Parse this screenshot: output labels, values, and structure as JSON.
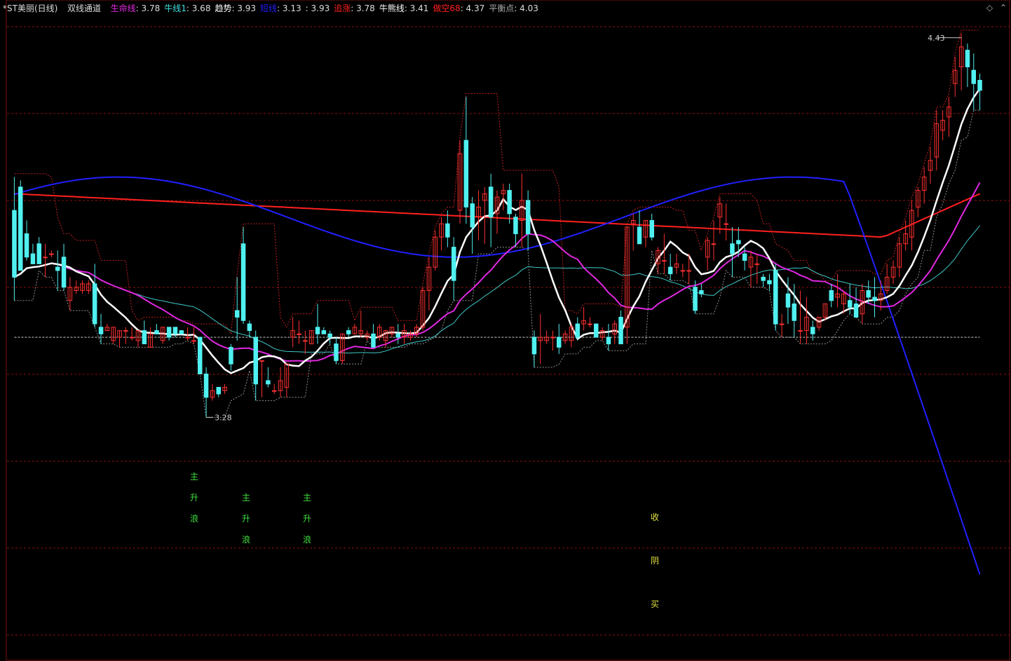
{
  "legend": {
    "stock": "*ST美丽(日线)",
    "indicator": "双线通道",
    "items": [
      {
        "label": "生命线",
        "value": "3.78",
        "color": "#e028e0"
      },
      {
        "label": "牛线1",
        "value": "3.68",
        "color": "#40e0e0"
      },
      {
        "label": "趋势",
        "value": "3.93",
        "color": "#ffffff"
      },
      {
        "label": "短线",
        "value": "3.13",
        "color": "#2020ff"
      },
      {
        "label": "",
        "value": "3.93",
        "color": "#ffffff"
      },
      {
        "label": "追涨",
        "value": "3.78",
        "color": "#ff2020"
      },
      {
        "label": "牛熊线",
        "value": "3.41",
        "color": "#ffffff"
      },
      {
        "label": "做空68",
        "value": "4.37",
        "color": "#ff2020"
      },
      {
        "label": "平衡点",
        "value": "4.03",
        "color": "#aaaaaa"
      }
    ]
  },
  "icons": [
    "diamond-icon",
    "chevron-up-icon"
  ],
  "chart_data": {
    "type": "candlestick",
    "high_marker": "4.43",
    "low_marker": "3.28",
    "annotations": [
      {
        "chars": [
          "主",
          "升",
          "浪"
        ],
        "color": "#40e040"
      },
      {
        "chars": [
          "主",
          "升",
          "浪"
        ],
        "color": "#40e040"
      },
      {
        "chars": [
          "主",
          "升",
          "浪"
        ],
        "color": "#40e040"
      },
      {
        "chars": [
          "收",
          "阴",
          "买"
        ],
        "color": "#e0e040"
      }
    ],
    "colors": {
      "up": "#ff3030",
      "down": "#50f0f0",
      "grid": "#8a1010",
      "trend_white": "#ffffff",
      "life_magenta": "#e028e0",
      "bull_cyan": "#40c8c8",
      "short_blue": "#2020ff",
      "long_red": "#ff2020",
      "balance": "#cccccc"
    },
    "candles": [
      [
        3.9,
        4.0,
        3.63,
        3.7
      ],
      [
        3.97,
        3.99,
        3.72,
        3.72
      ],
      [
        3.83,
        3.87,
        3.75,
        3.76
      ],
      [
        3.77,
        3.8,
        3.74,
        3.74
      ],
      [
        3.8,
        3.82,
        3.74,
        3.74
      ],
      [
        3.76,
        3.8,
        3.7,
        3.76
      ],
      [
        3.77,
        3.78,
        3.76,
        3.77
      ],
      [
        3.73,
        3.78,
        3.66,
        3.72
      ],
      [
        3.76,
        3.8,
        3.66,
        3.67
      ],
      [
        3.63,
        3.7,
        3.6,
        3.67
      ],
      [
        3.66,
        3.69,
        3.65,
        3.67
      ],
      [
        3.66,
        3.69,
        3.65,
        3.68
      ],
      [
        3.66,
        3.69,
        3.65,
        3.68
      ],
      [
        3.68,
        3.74,
        3.55,
        3.56
      ],
      [
        3.55,
        3.59,
        3.5,
        3.53
      ],
      [
        3.54,
        3.56,
        3.54,
        3.55
      ],
      [
        3.51,
        3.55,
        3.5,
        3.55
      ],
      [
        3.52,
        3.54,
        3.49,
        3.54
      ],
      [
        3.54,
        3.55,
        3.5,
        3.54
      ],
      [
        3.52,
        3.55,
        3.51,
        3.52
      ],
      [
        3.51,
        3.54,
        3.49,
        3.54
      ],
      [
        3.54,
        3.57,
        3.5,
        3.5
      ],
      [
        3.49,
        3.55,
        3.49,
        3.53
      ],
      [
        3.54,
        3.56,
        3.53,
        3.53
      ],
      [
        3.51,
        3.55,
        3.5,
        3.55
      ],
      [
        3.55,
        3.55,
        3.51,
        3.52
      ],
      [
        3.55,
        3.55,
        3.52,
        3.53
      ],
      [
        3.54,
        3.54,
        3.53,
        3.53
      ],
      [
        3.52,
        3.55,
        3.51,
        3.52
      ],
      [
        3.51,
        3.55,
        3.5,
        3.51
      ],
      [
        3.52,
        3.52,
        3.41,
        3.41
      ],
      [
        3.41,
        3.43,
        3.28,
        3.34
      ],
      [
        3.34,
        3.38,
        3.33,
        3.36
      ],
      [
        3.37,
        3.37,
        3.34,
        3.35
      ],
      [
        3.36,
        3.38,
        3.35,
        3.37
      ],
      [
        3.49,
        3.5,
        3.42,
        3.44
      ],
      [
        3.6,
        3.7,
        3.51,
        3.58
      ],
      [
        3.8,
        3.85,
        3.56,
        3.57
      ],
      [
        3.56,
        3.57,
        3.52,
        3.54
      ],
      [
        3.52,
        3.54,
        3.33,
        3.38
      ],
      [
        3.45,
        3.45,
        3.34,
        3.45
      ],
      [
        3.39,
        3.43,
        3.37,
        3.38
      ],
      [
        3.36,
        3.38,
        3.35,
        3.36
      ],
      [
        3.36,
        3.43,
        3.34,
        3.39
      ],
      [
        3.37,
        3.43,
        3.34,
        3.44
      ],
      [
        3.52,
        3.58,
        3.49,
        3.54
      ],
      [
        3.53,
        3.57,
        3.5,
        3.53
      ],
      [
        3.51,
        3.54,
        3.47,
        3.51
      ],
      [
        3.5,
        3.54,
        3.5,
        3.54
      ],
      [
        3.55,
        3.62,
        3.5,
        3.53
      ],
      [
        3.54,
        3.55,
        3.53,
        3.53
      ],
      [
        3.53,
        3.54,
        3.5,
        3.52
      ],
      [
        3.5,
        3.52,
        3.44,
        3.45
      ],
      [
        3.45,
        3.53,
        3.44,
        3.53
      ],
      [
        3.54,
        3.55,
        3.52,
        3.53
      ],
      [
        3.53,
        3.56,
        3.53,
        3.55
      ],
      [
        3.53,
        3.6,
        3.52,
        3.54
      ],
      [
        3.52,
        3.54,
        3.51,
        3.53
      ],
      [
        3.53,
        3.56,
        3.49,
        3.49
      ],
      [
        3.52,
        3.56,
        3.51,
        3.55
      ],
      [
        3.51,
        3.54,
        3.49,
        3.54
      ],
      [
        3.53,
        3.55,
        3.52,
        3.55
      ],
      [
        3.53,
        3.56,
        3.5,
        3.52
      ],
      [
        3.52,
        3.56,
        3.5,
        3.54
      ],
      [
        3.52,
        3.54,
        3.51,
        3.53
      ],
      [
        3.53,
        3.56,
        3.52,
        3.55
      ],
      [
        3.55,
        3.67,
        3.54,
        3.66
      ],
      [
        3.66,
        3.76,
        3.6,
        3.73
      ],
      [
        3.73,
        3.84,
        3.72,
        3.82
      ],
      [
        3.82,
        3.88,
        3.78,
        3.86
      ],
      [
        3.86,
        3.9,
        3.79,
        3.82
      ],
      [
        3.79,
        3.82,
        3.63,
        3.69
      ],
      [
        3.9,
        4.11,
        3.86,
        4.07
      ],
      [
        4.11,
        4.24,
        3.86,
        3.91
      ],
      [
        3.92,
        3.94,
        3.77,
        3.85
      ],
      [
        3.88,
        3.96,
        3.81,
        3.91
      ],
      [
        3.93,
        3.97,
        3.8,
        3.95
      ],
      [
        3.97,
        4.01,
        3.79,
        3.88
      ],
      [
        3.89,
        3.96,
        3.83,
        3.94
      ],
      [
        3.95,
        3.98,
        3.9,
        3.96
      ],
      [
        3.96,
        3.98,
        3.86,
        3.89
      ],
      [
        3.88,
        3.89,
        3.79,
        3.83
      ],
      [
        3.87,
        4.01,
        3.79,
        3.93
      ],
      [
        3.93,
        3.96,
        3.78,
        3.83
      ],
      [
        3.52,
        3.54,
        3.43,
        3.47
      ],
      [
        3.51,
        3.59,
        3.44,
        3.52
      ],
      [
        3.51,
        3.54,
        3.5,
        3.52
      ],
      [
        3.52,
        3.54,
        3.48,
        3.52
      ],
      [
        3.52,
        3.56,
        3.47,
        3.49
      ],
      [
        3.51,
        3.54,
        3.5,
        3.53
      ],
      [
        3.51,
        3.56,
        3.49,
        3.55
      ],
      [
        3.56,
        3.58,
        3.51,
        3.52
      ],
      [
        3.56,
        3.61,
        3.54,
        3.57
      ],
      [
        3.56,
        3.58,
        3.55,
        3.56
      ],
      [
        3.56,
        3.56,
        3.52,
        3.52
      ],
      [
        3.52,
        3.55,
        3.51,
        3.54
      ],
      [
        3.52,
        3.56,
        3.48,
        3.5
      ],
      [
        3.53,
        3.57,
        3.5,
        3.56
      ],
      [
        3.58,
        3.6,
        3.5,
        3.5
      ],
      [
        3.55,
        3.85,
        3.5,
        3.85
      ],
      [
        3.86,
        3.89,
        3.78,
        3.87
      ],
      [
        3.85,
        3.9,
        3.8,
        3.8
      ],
      [
        3.82,
        3.87,
        3.79,
        3.87
      ],
      [
        3.87,
        3.89,
        3.81,
        3.82
      ],
      [
        3.74,
        3.79,
        3.71,
        3.78
      ],
      [
        3.75,
        3.83,
        3.71,
        3.75
      ],
      [
        3.73,
        3.77,
        3.69,
        3.71
      ],
      [
        3.73,
        3.77,
        3.71,
        3.74
      ],
      [
        3.72,
        3.74,
        3.7,
        3.72
      ],
      [
        3.72,
        3.77,
        3.68,
        3.72
      ],
      [
        3.67,
        3.69,
        3.59,
        3.6
      ],
      [
        3.66,
        3.68,
        3.64,
        3.65
      ],
      [
        3.76,
        3.82,
        3.72,
        3.81
      ],
      [
        3.8,
        3.87,
        3.75,
        3.8
      ],
      [
        3.88,
        3.94,
        3.83,
        3.92
      ],
      [
        3.86,
        3.92,
        3.81,
        3.86
      ],
      [
        3.8,
        3.85,
        3.7,
        3.77
      ],
      [
        3.81,
        3.85,
        3.76,
        3.8
      ],
      [
        3.77,
        3.79,
        3.72,
        3.75
      ],
      [
        3.73,
        3.78,
        3.67,
        3.76
      ],
      [
        3.74,
        3.77,
        3.68,
        3.74
      ],
      [
        3.7,
        3.71,
        3.67,
        3.69
      ],
      [
        3.69,
        3.71,
        3.66,
        3.68
      ],
      [
        3.72,
        3.74,
        3.54,
        3.56
      ],
      [
        3.56,
        3.59,
        3.52,
        3.56
      ],
      [
        3.65,
        3.7,
        3.56,
        3.61
      ],
      [
        3.62,
        3.68,
        3.52,
        3.57
      ],
      [
        3.54,
        3.66,
        3.5,
        3.54
      ],
      [
        3.54,
        3.64,
        3.5,
        3.58
      ],
      [
        3.55,
        3.57,
        3.51,
        3.53
      ],
      [
        3.55,
        3.58,
        3.54,
        3.58
      ],
      [
        3.58,
        3.62,
        3.57,
        3.62
      ],
      [
        3.66,
        3.68,
        3.61,
        3.63
      ],
      [
        3.64,
        3.71,
        3.61,
        3.65
      ],
      [
        3.62,
        3.66,
        3.59,
        3.65
      ],
      [
        3.63,
        3.68,
        3.59,
        3.61
      ],
      [
        3.62,
        3.67,
        3.58,
        3.58
      ],
      [
        3.59,
        3.68,
        3.56,
        3.66
      ],
      [
        3.66,
        3.69,
        3.62,
        3.64
      ],
      [
        3.64,
        3.7,
        3.58,
        3.63
      ],
      [
        3.63,
        3.69,
        3.6,
        3.65
      ],
      [
        3.66,
        3.74,
        3.65,
        3.7
      ],
      [
        3.7,
        3.75,
        3.68,
        3.73
      ],
      [
        3.73,
        3.82,
        3.7,
        3.8
      ],
      [
        3.8,
        3.87,
        3.78,
        3.83
      ],
      [
        3.82,
        3.93,
        3.78,
        3.9
      ],
      [
        3.91,
        3.97,
        3.88,
        3.96
      ],
      [
        3.96,
        4.03,
        3.92,
        4.0
      ],
      [
        4.02,
        4.09,
        3.98,
        4.05
      ],
      [
        4.06,
        4.2,
        4.02,
        4.16
      ],
      [
        4.14,
        4.2,
        4.11,
        4.17
      ],
      [
        4.18,
        4.24,
        4.12,
        4.21
      ],
      [
        4.28,
        4.36,
        4.24,
        4.32
      ],
      [
        4.33,
        4.43,
        4.26,
        4.39
      ],
      [
        4.38,
        4.4,
        4.27,
        4.33
      ],
      [
        4.32,
        4.37,
        4.2,
        4.28
      ],
      [
        4.29,
        4.31,
        4.2,
        4.26
      ]
    ],
    "note": "candles = [open, high, low, close] per day"
  }
}
